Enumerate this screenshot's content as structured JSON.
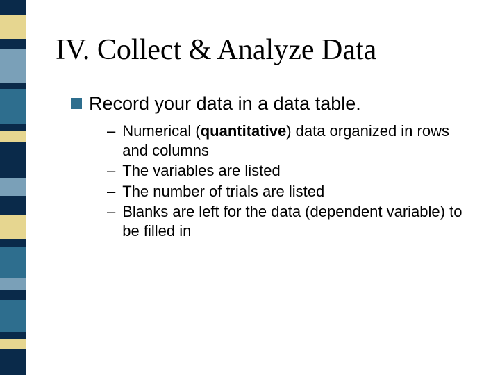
{
  "title": "IV. Collect & Analyze Data",
  "lvl1": {
    "text": "Record your data in a data table."
  },
  "lvl2": [
    {
      "pre": "Numerical (",
      "bold": "quantitative",
      "post": ") data organized in rows and columns"
    },
    {
      "pre": "The variables are listed",
      "bold": "",
      "post": ""
    },
    {
      "pre": "The number of trials are listed",
      "bold": "",
      "post": ""
    },
    {
      "pre": "Blanks are left for the data (dependent variable) to be filled in",
      "bold": "",
      "post": ""
    }
  ],
  "stripes": [
    {
      "h": 22,
      "c": "#0a2a4a"
    },
    {
      "h": 34,
      "c": "#e6d690"
    },
    {
      "h": 14,
      "c": "#0a2a4a"
    },
    {
      "h": 50,
      "c": "#7aa0b8"
    },
    {
      "h": 8,
      "c": "#0a2a4a"
    },
    {
      "h": 50,
      "c": "#2e6e8e"
    },
    {
      "h": 10,
      "c": "#0a2a4a"
    },
    {
      "h": 16,
      "c": "#e6d690"
    },
    {
      "h": 52,
      "c": "#0a2a4a"
    },
    {
      "h": 26,
      "c": "#7aa0b8"
    },
    {
      "h": 28,
      "c": "#0a2a4a"
    },
    {
      "h": 34,
      "c": "#e6d690"
    },
    {
      "h": 12,
      "c": "#0a2a4a"
    },
    {
      "h": 44,
      "c": "#2e6e8e"
    },
    {
      "h": 18,
      "c": "#7aa0b8"
    },
    {
      "h": 14,
      "c": "#0a2a4a"
    },
    {
      "h": 46,
      "c": "#2e6e8e"
    },
    {
      "h": 10,
      "c": "#0a2a4a"
    },
    {
      "h": 14,
      "c": "#e6d690"
    },
    {
      "h": 38,
      "c": "#0a2a4a"
    }
  ]
}
